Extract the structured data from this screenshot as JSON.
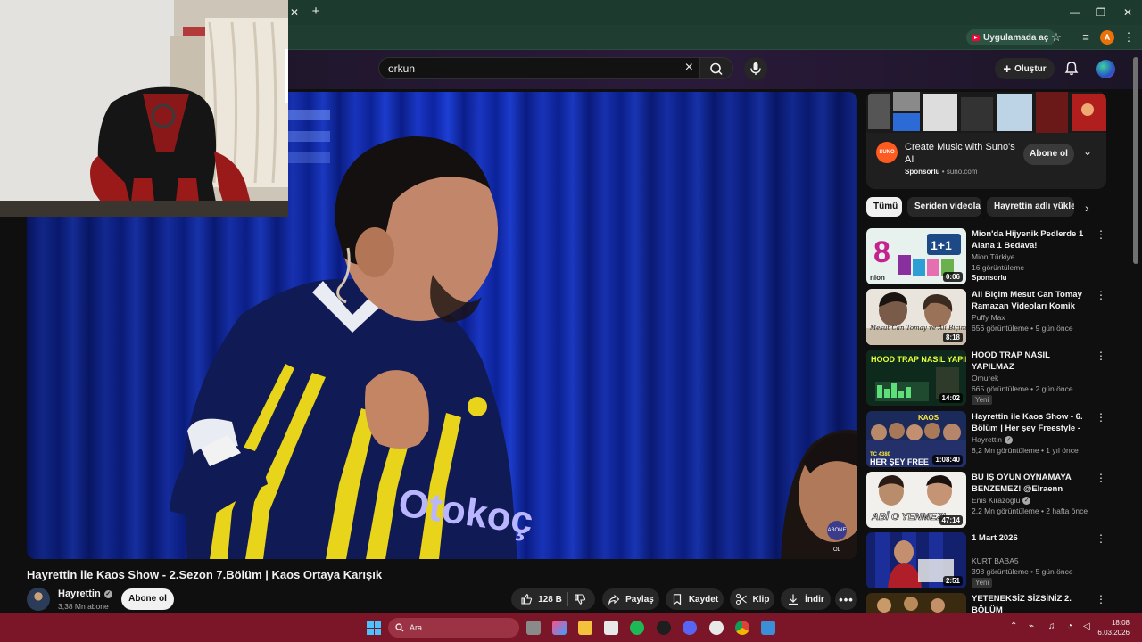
{
  "browser": {
    "open_in_app_label": "Uygulamada aç",
    "profile_initial": "A"
  },
  "header": {
    "search_query": "orkun",
    "create_label": "Oluştur"
  },
  "video": {
    "title": "Hayrettin ile Kaos Show - 2.Sezon 7.Bölüm | Kaos Ortaya Karışık",
    "channel_name": "Hayrettin",
    "subscribers": "3,38 Mn abone",
    "subscribe_label": "Abone ol",
    "likes": "128 B",
    "share_label": "Paylaş",
    "save_label": "Kaydet",
    "clip_label": "Klip",
    "download_label": "İndir"
  },
  "ad": {
    "title": "Create Music with Suno's AI",
    "sponsored": "Sponsorlu",
    "domain": "suno.com",
    "subscribe_label": "Abone ol",
    "logo_text": "SUNO"
  },
  "chips": [
    "Tümü",
    "Seriden videolar",
    "Hayrettin adlı yükleyici"
  ],
  "recommendations": [
    {
      "title": "Mion'da Hijyenik Pedlerde 1 Alana 1 Bedava!",
      "channel": "Mion Türkiye",
      "meta": "16 görüntüleme",
      "badge": "Sponsorlu",
      "duration": "0:06",
      "verified": false,
      "badge_style": "sponsor"
    },
    {
      "title": "Ali Biçim Mesut Can Tomay Ramazan Videoları Komik Anl…",
      "channel": "Puffy Max",
      "meta": "656 görüntüleme • 9 gün önce",
      "badge": "",
      "duration": "8:18",
      "verified": false,
      "badge_style": ""
    },
    {
      "title": "HOOD TRAP NASIL YAPILMAZ",
      "channel": "Omurek",
      "meta": "665 görüntüleme • 2 gün önce",
      "badge": "Yeni",
      "duration": "14:02",
      "verified": false,
      "badge_style": "new"
    },
    {
      "title": "Hayrettin ile Kaos Show - 6. Bölüm | Her şey Freestyle - TC …",
      "channel": "Hayrettin",
      "meta": "8,2 Mn görüntüleme • 1 yıl önce",
      "badge": "",
      "duration": "1:08:40",
      "verified": true,
      "badge_style": ""
    },
    {
      "title": "BU İŞ OYUN OYNAMAYA BENZEMEZ! @Elraenn YEMEK …",
      "channel": "Enis Kirazoglu",
      "meta": "2,2 Mn görüntüleme • 2 hafta önce",
      "badge": "",
      "duration": "47:14",
      "verified": true,
      "badge_style": ""
    },
    {
      "title": "1 Mart 2026",
      "channel": "KURT BABA5",
      "meta": "398 görüntüleme • 5 gün önce",
      "badge": "Yeni",
      "duration": "2:51",
      "verified": false,
      "badge_style": "new"
    },
    {
      "title": "YETENEKSİZ SİZSİNİZ 2. BÖLÜM",
      "channel": "",
      "meta": "",
      "badge": "",
      "duration": "",
      "verified": false,
      "badge_style": ""
    }
  ],
  "thumb_texts": {
    "r0_brand": "nion",
    "r0_promo": "1+1",
    "r1_caption": "Mesut Can Tomay ve Ali Biçim",
    "r2_caption": "HOOD TRAP NASIL YAPILMAZ",
    "r3_top": "KAOS",
    "r3_caption": "HER ŞEY FREE",
    "r3_code": "TC 4380",
    "r4_caption": "ABİ O YENMEZ!"
  },
  "jersey_text": "Otokoç",
  "channel_bug_text": "ABONE OL",
  "taskbar": {
    "search_placeholder": "Ara",
    "time": "18:08",
    "date": "6.03.2026"
  },
  "colors": {
    "yt_red": "#ff0033",
    "taskbar": "#7a1628",
    "browser_chrome": "#1d3a2e"
  }
}
